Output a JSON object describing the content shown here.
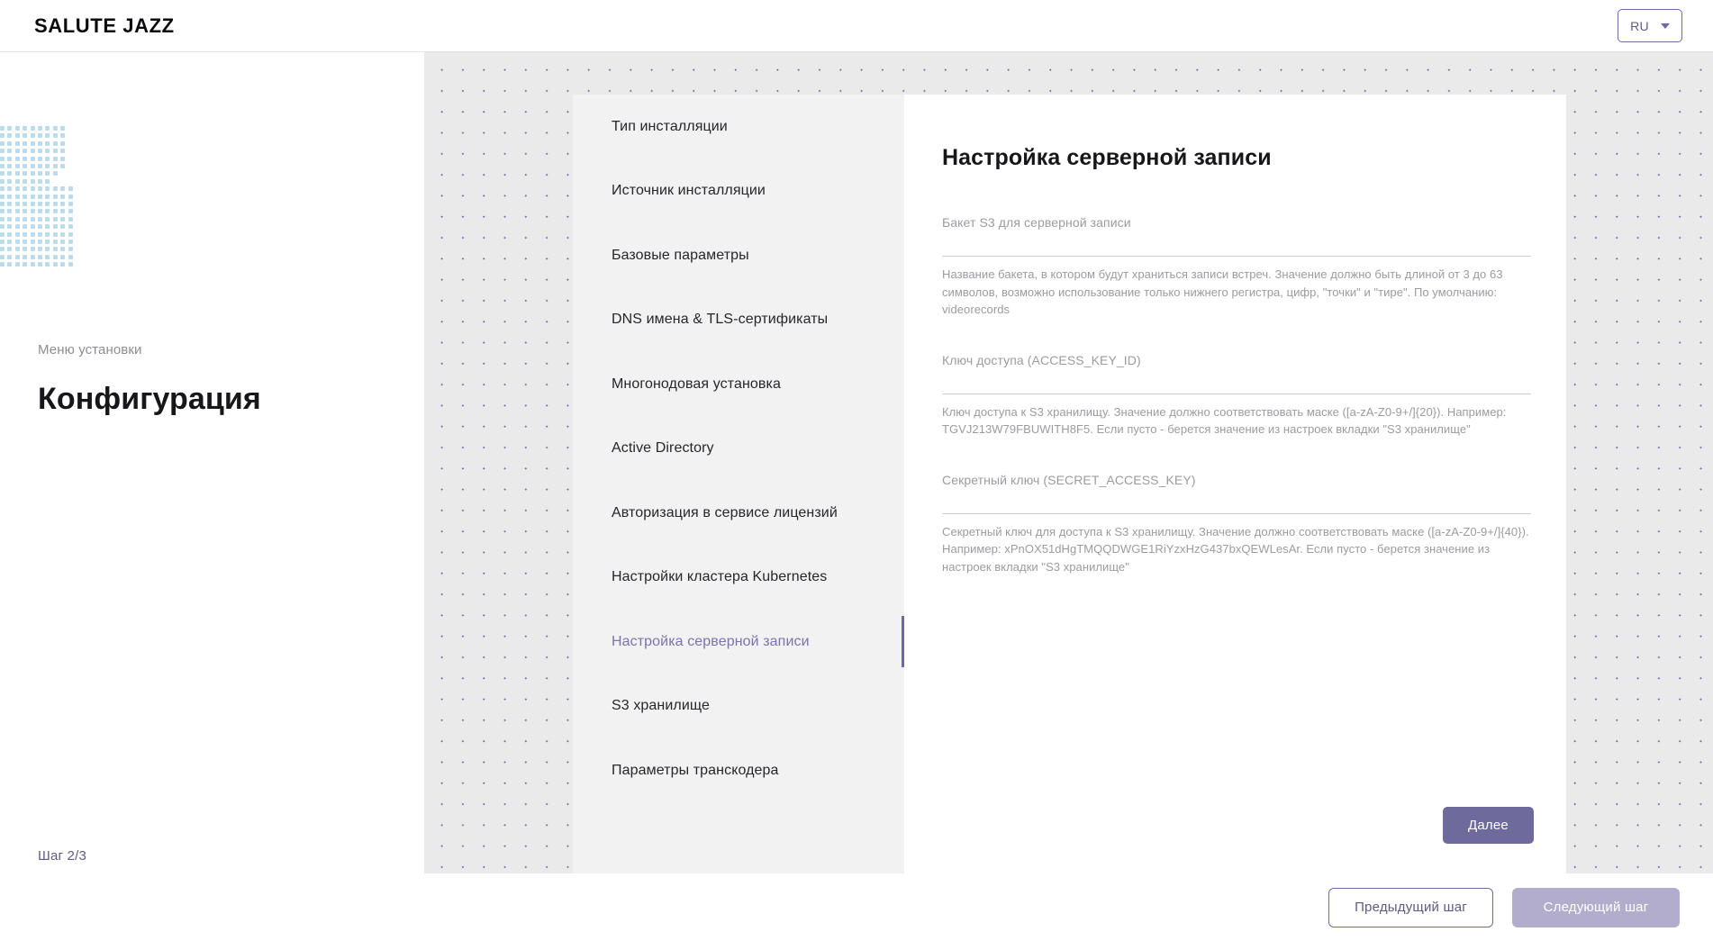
{
  "header": {
    "brand": "SALUTE JAZZ",
    "language": {
      "selected": "RU",
      "icon": "chevron-down-icon"
    }
  },
  "left_panel": {
    "kicker": "Меню установки",
    "title": "Конфигурация",
    "step": {
      "label": "Шаг 2/3",
      "percent": 66,
      "fill_color": "#6f6a9c",
      "track_color": "#e2e2e4"
    },
    "decoration": "dotted-quarter-circle"
  },
  "menu": {
    "items": [
      {
        "label": "Тип инсталляции",
        "active": false
      },
      {
        "label": "Источник инсталляции",
        "active": false
      },
      {
        "label": "Базовые параметры",
        "active": false
      },
      {
        "label": "DNS имена & TLS-сертификаты",
        "active": false
      },
      {
        "label": "Многонодовая установка",
        "active": false
      },
      {
        "label": "Active Directory",
        "active": false
      },
      {
        "label": "Авторизация в сервисе лицензий",
        "active": false
      },
      {
        "label": "Настройки кластера Kubernetes",
        "active": false
      },
      {
        "label": "Настройка серверной записи",
        "active": true
      },
      {
        "label": "S3 хранилище",
        "active": false
      },
      {
        "label": "Параметры транскодера",
        "active": false
      }
    ],
    "active_color": "#7a74ad"
  },
  "content": {
    "title": "Настройка серверной записи",
    "fields": [
      {
        "label": "Бакет S3 для серверной записи",
        "value": "",
        "placeholder": "",
        "help": "Название бакета, в котором будут храниться записи встреч. Значение должно быть длиной от 3 до 63 символов, возможно использование только нижнего регистра, цифр, \"точки\" и \"тире\". По умолчанию: videorecords"
      },
      {
        "label": "Ключ доступа (ACCESS_KEY_ID)",
        "value": "",
        "placeholder": "",
        "help": "Ключ доступа к S3 хранилищу. Значение должно соответствовать маске ([a-zA-Z0-9+/]{20}). Например: TGVJ213W79FBUWITH8F5. Если пусто - берется значение из настроек вкладки \"S3 хранилище\""
      },
      {
        "label": "Секретный ключ (SECRET_ACCESS_KEY)",
        "value": "",
        "placeholder": "",
        "help": "Секретный ключ для доступа к S3 хранилищу. Значение должно соответствовать маске ([a-zA-Z0-9+/]{40}). Например: xPnOX51dHgTMQQDWGE1RiYzxHzG437bxQEWLesAr. Если пусто - берется значение из настроек вкладки \"S3 хранилище\""
      }
    ],
    "next_button": "Далее"
  },
  "footer": {
    "previous_step": "Предыдущий шаг",
    "next_step": "Следующий шаг"
  },
  "colors": {
    "accent": "#6f6a9c",
    "accent_muted": "#b2adcd",
    "canvas": "#eaeaea",
    "menu_card": "#f2f2f2",
    "deco_dot": "#bcdcec"
  }
}
